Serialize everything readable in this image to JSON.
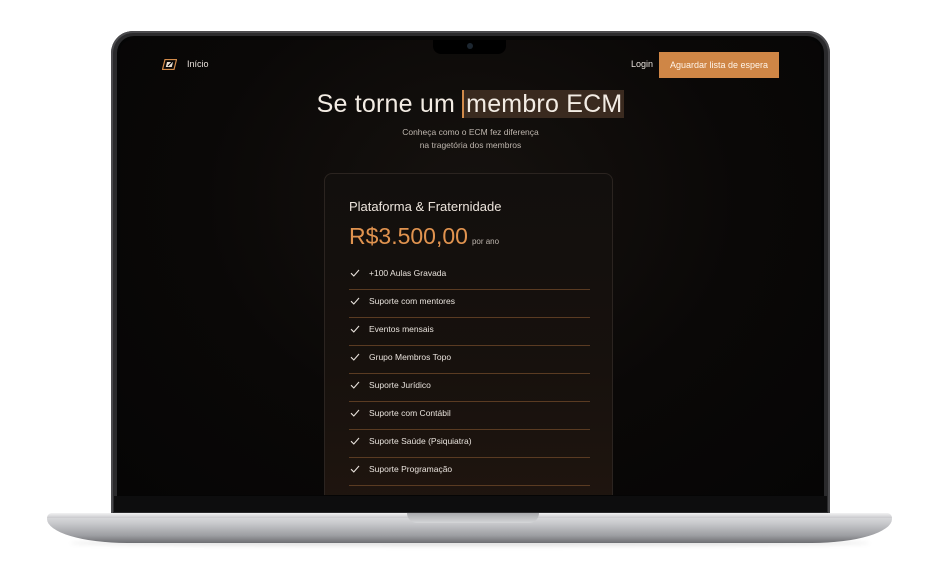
{
  "nav": {
    "logo_icon": "ecm-logo-icon",
    "home_label": "Início",
    "login_label": "Login",
    "cta_label": "Aguardar lista de espera"
  },
  "hero": {
    "title_prefix": "Se torne um",
    "title_highlight": "membro ECM",
    "subtitle_line1": "Conheça como o ECM fez diferença",
    "subtitle_line2": "na tragetória dos membros"
  },
  "plan": {
    "name": "Plataforma & Fraternidade",
    "price": "R$3.500,00",
    "period": "por ano",
    "features": [
      "+100 Aulas Gravada",
      "Suporte com mentores",
      "Eventos mensais",
      "Grupo Membros Topo",
      "Suporte Jurídico",
      "Suporte com Contábil",
      "Suporte Saúde (Psiquiatra)",
      "Suporte Programação"
    ]
  },
  "colors": {
    "accent": "#cf8646",
    "price": "#e0934f",
    "background": "#0a0807"
  }
}
